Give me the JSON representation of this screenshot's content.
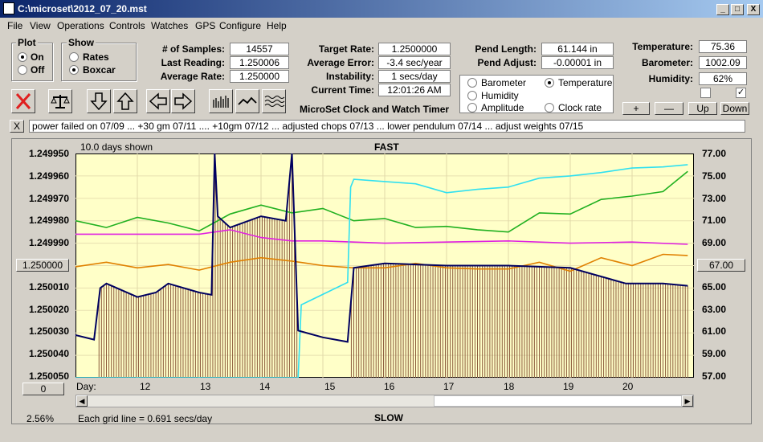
{
  "window": {
    "title": "C:\\microset\\2012_07_20.mst",
    "min": "_",
    "max": "□",
    "close": "X"
  },
  "menu": [
    "File",
    "View",
    "Operations",
    "Controls",
    "Watches",
    "GPS",
    "Configure",
    "Help"
  ],
  "plot_group": {
    "title": "Plot",
    "on": "On",
    "off": "Off",
    "selected": "On"
  },
  "show_group": {
    "title": "Show",
    "rates": "Rates",
    "boxcar": "Boxcar",
    "selected": "Boxcar"
  },
  "stats": {
    "samples_label": "# of Samples:",
    "samples": "14557",
    "last_label": "Last Reading:",
    "last": "1.250006",
    "avg_label": "Average Rate:",
    "avg": "1.250000"
  },
  "rates": {
    "target_label": "Target Rate:",
    "target": "1.2500000",
    "error_label": "Average Error:",
    "error": "-3.4 sec/year",
    "instab_label": "Instability:",
    "instab": "1 secs/day",
    "time_label": "Current Time:",
    "time": "12:01:26 AM"
  },
  "pend": {
    "length_label": "Pend Length:",
    "length": "61.144 in",
    "adjust_label": "Pend Adjust:",
    "adjust": "-0.00001 in"
  },
  "env": {
    "temp_label": "Temperature:",
    "temp": "75.36",
    "baro_label": "Barometer:",
    "baro": "1002.09",
    "hum_label": "Humidity:",
    "hum": "62%"
  },
  "trace_select": {
    "barometer": "Barometer",
    "temperature": "Temperature",
    "humidity": "Humidity",
    "amplitude": "Amplitude",
    "clockrate": "Clock rate",
    "selected": "Temperature"
  },
  "scale_buttons": {
    "plus": "+",
    "minus": "—",
    "up": "Up",
    "down": "Down"
  },
  "app_name": "MicroSet Clock and Watch Timer",
  "notes": "power failed on 07/09  ...  +30 gm 07/11  ....  +10gm 07/12  ...  adjusted chops 07/13  ...  lower pendulum 07/14  ...  adjust weights 07/15",
  "notes_close": "X",
  "plot": {
    "days_shown": "10.0 days shown",
    "top_label": "FAST",
    "bottom_label": "SLOW",
    "grid_note": "Each grid line = 0.691 secs/day",
    "zoom": "2.56%",
    "left_center_btn": "1.250000",
    "right_center_btn": "67.00",
    "bottom_left_btn": "0",
    "day_label": "Day:"
  },
  "colors": {
    "plot_bg": "#ffffc8",
    "rate": "#000060",
    "boxcar": "#8b5a3c",
    "temperature": "#20b020",
    "humidity": "#e020e0",
    "barometer": "#e08000",
    "amplitude": "#30e0f0"
  },
  "chart_data": {
    "type": "line",
    "left_axis": {
      "ticks": [
        "1.249950",
        "1.249960",
        "1.249970",
        "1.249980",
        "1.249990",
        "1.250000",
        "1.250010",
        "1.250020",
        "1.250030",
        "1.250040",
        "1.250050"
      ],
      "ylim": [
        1.24995,
        1.25005
      ],
      "inverted": true
    },
    "right_axis": {
      "ticks": [
        "77.00",
        "75.00",
        "73.00",
        "71.00",
        "69.00",
        "67.00",
        "65.00",
        "63.00",
        "61.00",
        "59.00",
        "57.00"
      ],
      "ylim": [
        57,
        77
      ]
    },
    "x_ticks": [
      "12",
      "13",
      "14",
      "15",
      "16",
      "17",
      "18",
      "19",
      "20"
    ],
    "x_range": [
      11,
      21
    ],
    "series": [
      {
        "name": "Temperature",
        "axis": "right",
        "x": [
          11,
          11.5,
          12,
          12.5,
          13,
          13.5,
          14,
          14.5,
          15,
          15.5,
          16,
          16.5,
          17,
          17.5,
          18,
          18.5,
          19,
          19.5,
          20,
          20.5,
          20.9
        ],
        "values": [
          71.0,
          70.4,
          71.3,
          70.8,
          70.1,
          71.6,
          72.4,
          71.7,
          72.1,
          71.0,
          71.2,
          70.4,
          70.5,
          70.2,
          70.0,
          71.7,
          71.6,
          72.9,
          73.2,
          73.6,
          75.4
        ]
      },
      {
        "name": "Humidity",
        "axis": "right",
        "x": [
          11,
          12,
          13,
          13.5,
          14,
          14.5,
          15,
          16,
          17,
          18,
          19,
          20,
          20.9
        ],
        "values": [
          69.8,
          69.8,
          69.8,
          70.2,
          69.5,
          69.2,
          69.2,
          69.0,
          69.1,
          69.2,
          69.0,
          69.1,
          68.9
        ]
      },
      {
        "name": "Barometer",
        "axis": "right",
        "x": [
          11,
          11.5,
          12,
          12.5,
          13,
          13.5,
          14,
          14.5,
          15,
          15.5,
          16,
          16.5,
          17,
          17.5,
          18,
          18.5,
          19,
          19.5,
          20,
          20.5,
          20.9
        ],
        "values": [
          66.9,
          67.3,
          66.8,
          67.1,
          66.6,
          67.3,
          67.7,
          67.4,
          67.0,
          66.8,
          66.8,
          67.2,
          66.8,
          66.7,
          66.7,
          67.3,
          66.5,
          67.7,
          67.0,
          68.0,
          67.9
        ]
      },
      {
        "name": "Amplitude",
        "axis": "right",
        "x": [
          11,
          14.6,
          14.65,
          15.4,
          15.45,
          15.5,
          16,
          16.5,
          17,
          17.5,
          18,
          18.5,
          19,
          19.5,
          20,
          20.5,
          20.9
        ],
        "values": [
          57,
          57,
          63.5,
          65.5,
          74.0,
          74.7,
          74.5,
          74.3,
          73.5,
          73.8,
          74.0,
          74.8,
          75.0,
          75.3,
          75.7,
          75.8,
          76.0
        ]
      },
      {
        "name": "Clock rate",
        "axis": "left",
        "x": [
          11,
          11.3,
          11.4,
          11.5,
          12,
          12.3,
          12.5,
          13,
          13.2,
          13.25,
          13.3,
          13.5,
          14,
          14.4,
          14.5,
          14.6,
          15,
          15.4,
          15.5,
          16,
          17,
          18,
          19,
          19.9,
          20,
          20.5,
          20.9
        ],
        "values": [
          1.250031,
          1.250033,
          1.25001,
          1.250008,
          1.250014,
          1.250012,
          1.250008,
          1.250012,
          1.250013,
          1.24995,
          1.249978,
          1.249983,
          1.249978,
          1.24998,
          1.24995,
          1.250029,
          1.250032,
          1.250034,
          1.250001,
          1.249999,
          1.25,
          1.25,
          1.250001,
          1.250008,
          1.250008,
          1.250008,
          1.250009
        ]
      }
    ]
  }
}
